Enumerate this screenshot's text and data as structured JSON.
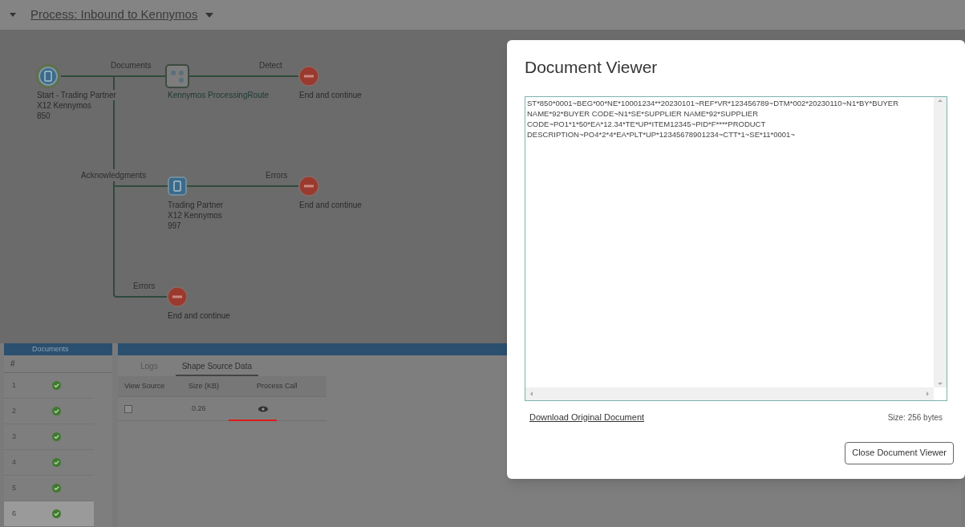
{
  "header": {
    "title": "Process: Inbound to Kennymos"
  },
  "diagram": {
    "nodes": [
      {
        "kind": "start",
        "lines": [
          "Start - Trading Partner",
          "X12 Kennymos",
          "850"
        ]
      },
      {
        "kind": "process",
        "lines": [
          "Kennymos ProcessingRoute"
        ]
      },
      {
        "kind": "end",
        "lines": [
          "End and continue"
        ]
      },
      {
        "kind": "partner",
        "lines": [
          "Trading Partner",
          "X12 Kennymos",
          "997"
        ]
      },
      {
        "kind": "end",
        "lines": [
          "End and continue"
        ]
      },
      {
        "kind": "end",
        "lines": [
          "End and continue"
        ]
      }
    ],
    "edge_labels": [
      "Documents",
      "Detect",
      "Acknowledgments",
      "Errors",
      "Errors"
    ]
  },
  "documents": {
    "title": "Documents",
    "column": "#",
    "rows": [
      {
        "number": "1",
        "selected": false
      },
      {
        "number": "2",
        "selected": false
      },
      {
        "number": "3",
        "selected": false
      },
      {
        "number": "4",
        "selected": false
      },
      {
        "number": "5",
        "selected": false
      },
      {
        "number": "6",
        "selected": true
      }
    ]
  },
  "tabs": [
    {
      "label": "Logs",
      "selected": false
    },
    {
      "label": "Shape Source Data",
      "selected": true
    }
  ],
  "table": {
    "columns": [
      "View Source",
      "Size (KB)",
      "Process Call"
    ],
    "rows": [
      {
        "size": "0.26"
      }
    ]
  },
  "dialog": {
    "title": "Document Viewer",
    "content": "ST*850*0001~BEG*00*NE*10001234**20230101~REF*VR*123456789~DTM*002*20230110~N1*BY*BUYER NAME*92*BUYER CODE~N1*SE*SUPPLIER NAME*92*SUPPLIER CODE~PO1*1*50*EA*12.34*TE*UP*ITEM12345~PID*F****PRODUCT DESCRIPTION~PO4*2*4*EA*PLT*UP*12345678901234~CTT*1~SE*11*0001~",
    "download_link": "Download Original Document",
    "size": "Size: 256 bytes",
    "close_button": "Close Document Viewer"
  }
}
